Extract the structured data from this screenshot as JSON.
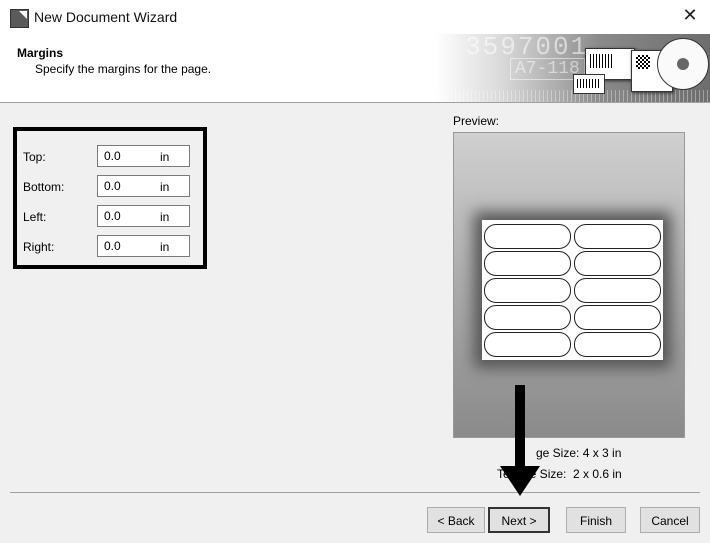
{
  "window": {
    "title": "New Document Wizard",
    "close_glyph": "✕"
  },
  "header": {
    "title": "Margins",
    "subtitle": "Specify the margins for the page.",
    "banner": {
      "number_text": "3597001",
      "code_text": "A7-118"
    }
  },
  "margins": {
    "fields": [
      {
        "label": "Top:",
        "value": "0.0",
        "unit": "in"
      },
      {
        "label": "Bottom:",
        "value": "0.0",
        "unit": "in"
      },
      {
        "label": "Left:",
        "value": "0.0",
        "unit": "in"
      },
      {
        "label": "Right:",
        "value": "0.0",
        "unit": "in"
      }
    ]
  },
  "preview": {
    "label": "Preview:",
    "page_size": "ge Size:  4 x 3 in",
    "template_size": "Te     te Size:  2 x 0.6 in",
    "rows": 5,
    "columns": 2
  },
  "buttons": {
    "back": "< Back",
    "next": "Next >",
    "finish": "Finish",
    "cancel": "Cancel"
  },
  "colors": {
    "background": "#f0f0f0",
    "highlight_box": "#000000",
    "annotation_arrow": "#000000"
  },
  "icons": {
    "app": "document-icon",
    "close": "close-icon",
    "annotation": "arrow-down-icon"
  }
}
